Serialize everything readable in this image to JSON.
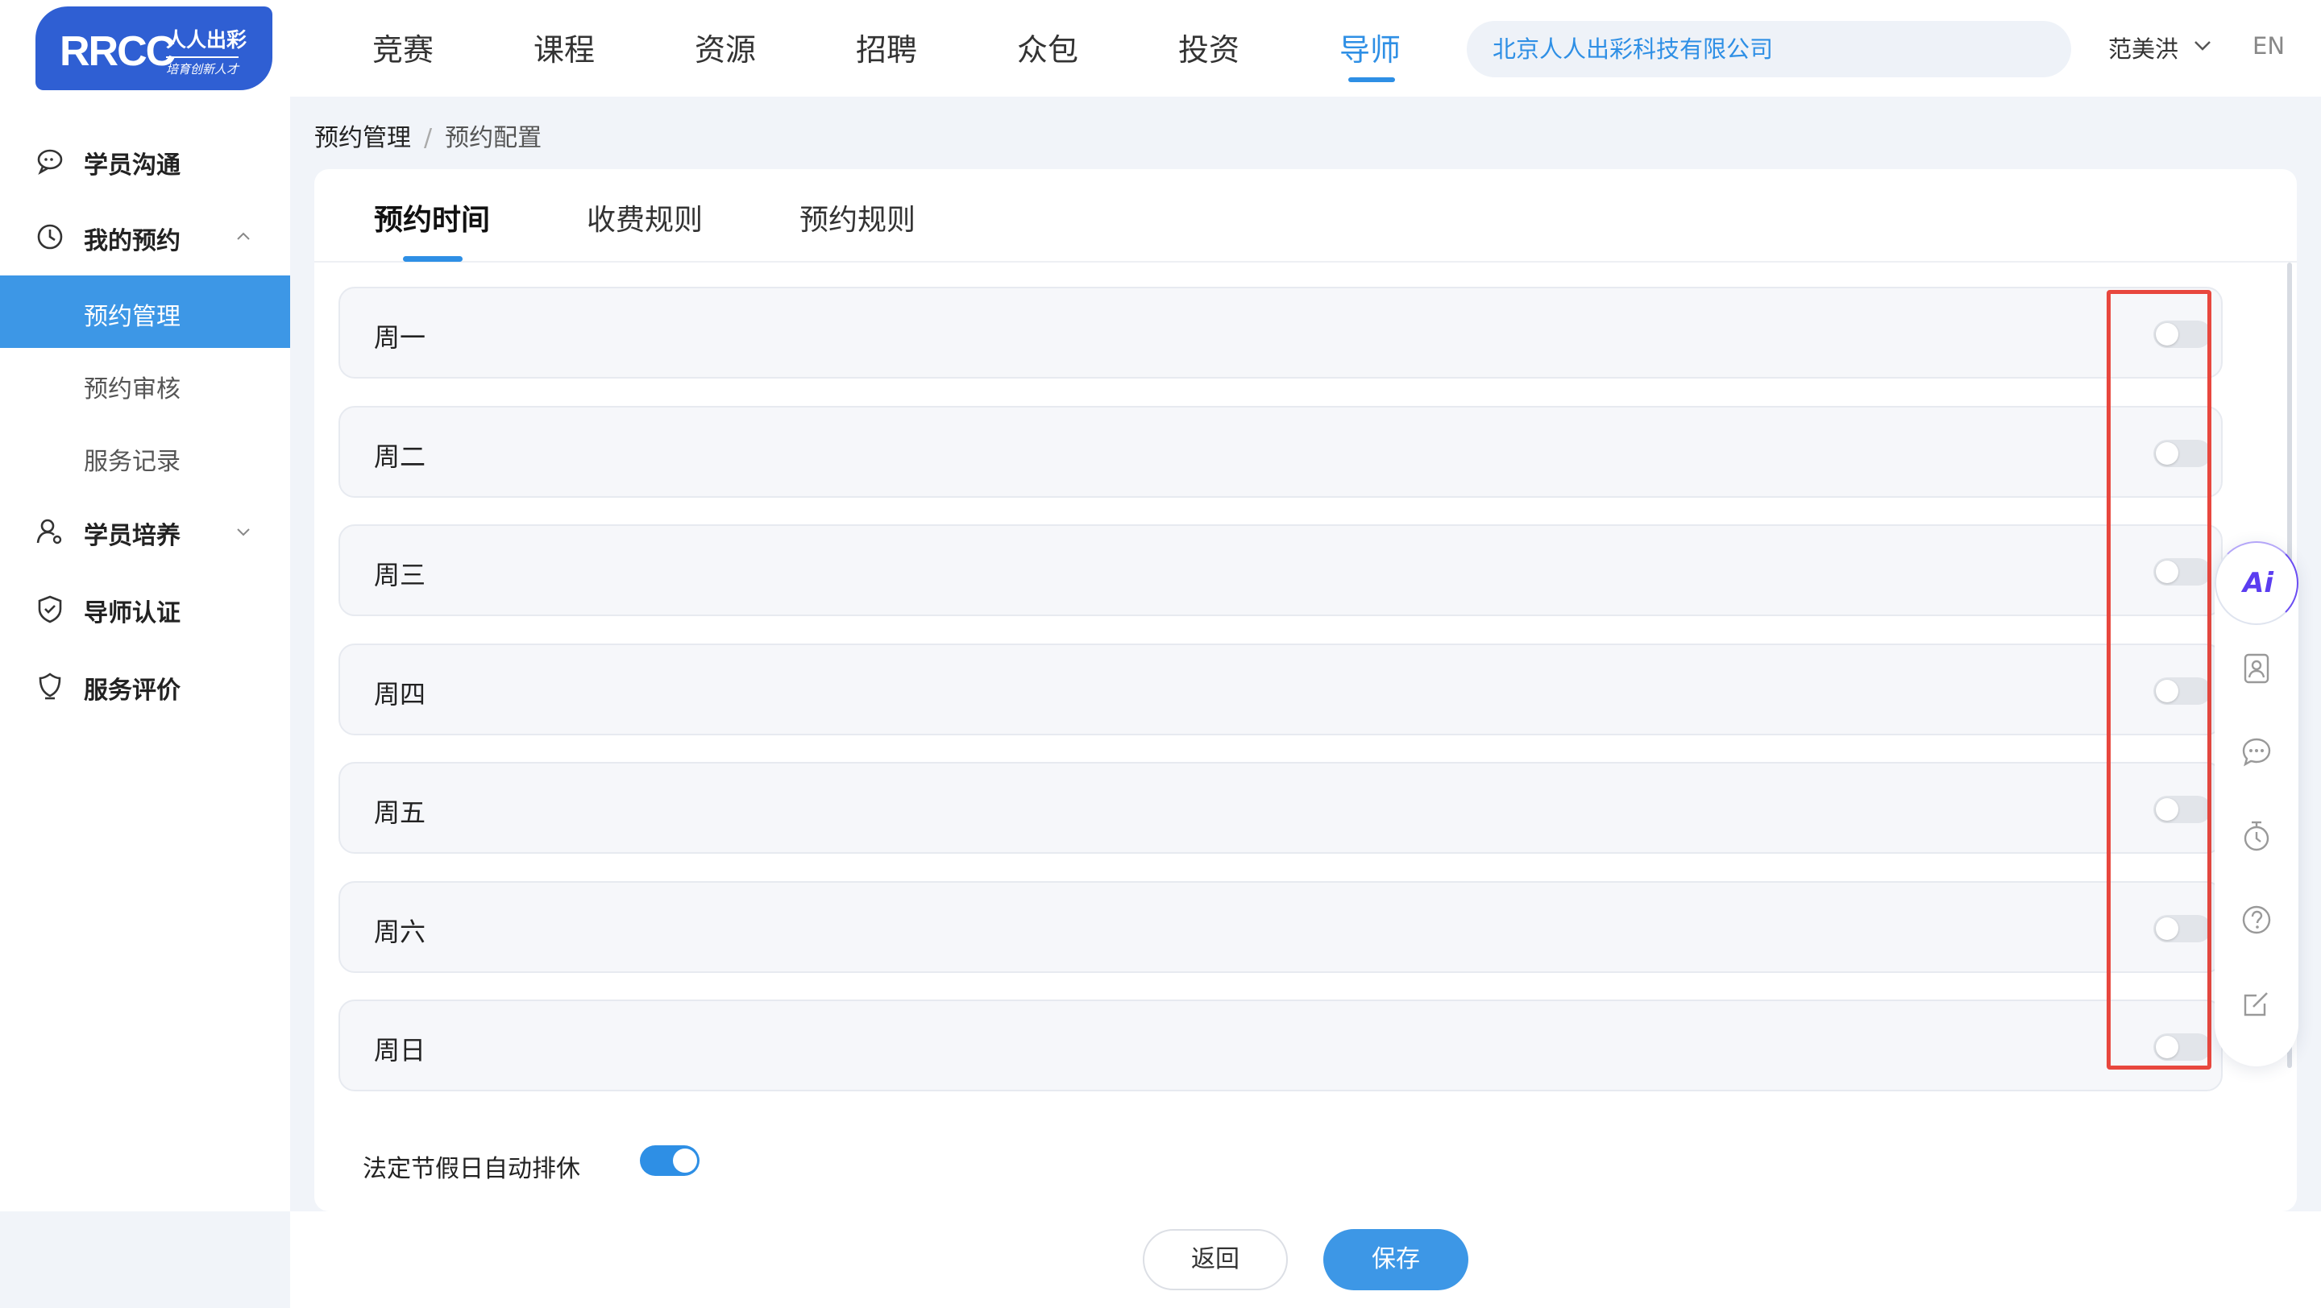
{
  "header": {
    "logo": {
      "brand": "RRCC",
      "name": "人人出彩",
      "slogan": "培育创新人才"
    },
    "nav": [
      {
        "label": "竞赛"
      },
      {
        "label": "课程"
      },
      {
        "label": "资源"
      },
      {
        "label": "招聘"
      },
      {
        "label": "众包"
      },
      {
        "label": "投资"
      },
      {
        "label": "导师",
        "active": true
      }
    ],
    "company": "北京人人出彩科技有限公司",
    "user": "范美洪",
    "language": "EN"
  },
  "sidebar": {
    "items": [
      {
        "label": "学员沟通",
        "icon": "chat-icon"
      },
      {
        "label": "我的预约",
        "icon": "clock-icon",
        "expanded": true
      },
      {
        "label": "学员培养",
        "icon": "person-icon",
        "expanded": false
      },
      {
        "label": "导师认证",
        "icon": "shield-icon"
      },
      {
        "label": "服务评价",
        "icon": "badge-icon"
      }
    ],
    "subitems": [
      {
        "label": "预约管理",
        "active": true
      },
      {
        "label": "预约审核"
      },
      {
        "label": "服务记录"
      }
    ]
  },
  "breadcrumb": {
    "parent": "预约管理",
    "separator": "/",
    "current": "预约配置"
  },
  "tabs": [
    {
      "label": "预约时间",
      "active": true
    },
    {
      "label": "收费规则"
    },
    {
      "label": "预约规则"
    }
  ],
  "days": [
    {
      "label": "周一",
      "enabled": false
    },
    {
      "label": "周二",
      "enabled": false
    },
    {
      "label": "周三",
      "enabled": false
    },
    {
      "label": "周四",
      "enabled": false
    },
    {
      "label": "周五",
      "enabled": false
    },
    {
      "label": "周六",
      "enabled": false
    },
    {
      "label": "周日",
      "enabled": false
    }
  ],
  "holiday": {
    "label": "法定节假日自动排休",
    "enabled": true
  },
  "toolbox": {
    "ai_label": "Ai",
    "items": [
      "contact-card-icon",
      "message-icon",
      "timer-icon",
      "help-icon",
      "edit-icon"
    ]
  },
  "footer": {
    "back_label": "返回",
    "save_label": "保存"
  },
  "colors": {
    "accent": "#2e8fe5",
    "sidebar_active": "#3d97e6",
    "highlight_box": "#e8473e",
    "ai_purple": "#5b3df0"
  }
}
